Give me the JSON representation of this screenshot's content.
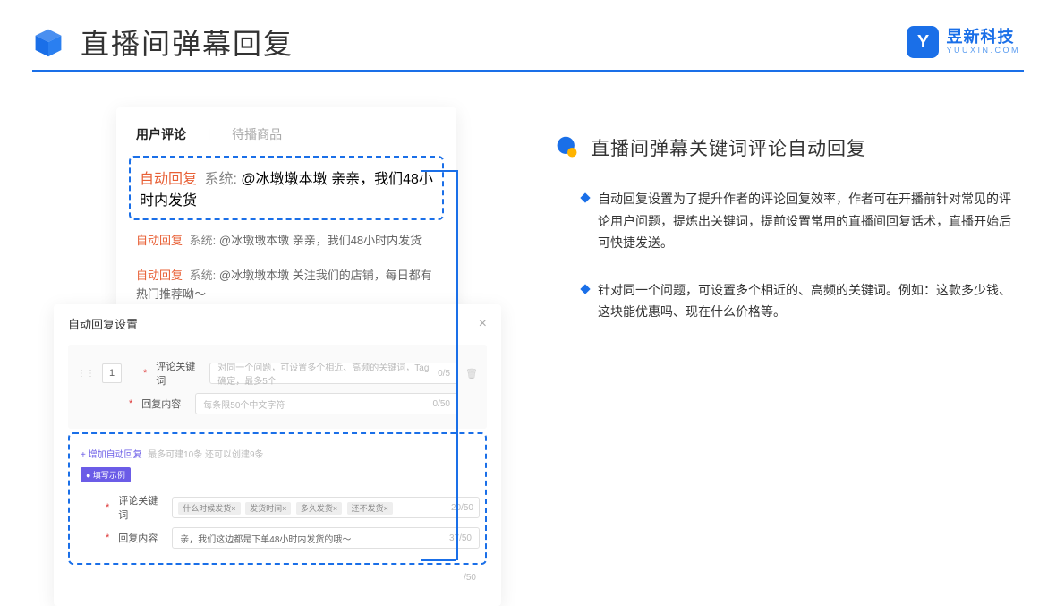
{
  "header": {
    "title": "直播间弹幕回复",
    "logo_cn": "昱新科技",
    "logo_en": "YUUXIN.COM",
    "logo_letter": "Y"
  },
  "comments": {
    "tab_active": "用户评论",
    "tab_inactive": "待播商品",
    "rows": [
      {
        "auto": "自动回复",
        "sys": "系统:",
        "text": "@冰墩墩本墩 亲亲，我们48小时内发货"
      },
      {
        "auto": "自动回复",
        "sys": "系统:",
        "text": "@冰墩墩本墩 亲亲，我们48小时内发货"
      },
      {
        "auto": "自动回复",
        "sys": "系统:",
        "text": "@冰墩墩本墩 关注我们的店铺，每日都有热门推荐呦～"
      }
    ]
  },
  "settings": {
    "title": "自动回复设置",
    "row_num": "1",
    "keyword_label": "评论关键词",
    "keyword_placeholder": "对同一个问题，可设置多个相近、高频的关键词，Tag确定，最多5个",
    "keyword_count": "0/5",
    "content_label": "回复内容",
    "content_placeholder": "每条限50个中文字符",
    "content_count": "0/50",
    "add_label": "+ 增加自动回复",
    "add_hint": "最多可建10条 还可以创建9条",
    "example_badge": "● 填写示例",
    "ex_keyword_label": "评论关键词",
    "ex_tags": [
      "什么时候发货×",
      "发货时间×",
      "多久发货×",
      "还不发货×"
    ],
    "ex_keyword_count": "20/50",
    "ex_content_label": "回复内容",
    "ex_content_value": "亲，我们这边都是下单48小时内发货的哦～",
    "ex_content_count": "37/50",
    "extra_count": "/50"
  },
  "right": {
    "section_title": "直播间弹幕关键词评论自动回复",
    "bullets": [
      "自动回复设置为了提升作者的评论回复效率，作者可在开播前针对常见的评论用户问题，提炼出关键词，提前设置常用的直播间回复话术，直播开始后可快捷发送。",
      "针对同一个问题，可设置多个相近的、高频的关键词。例如：这款多少钱、这块能优惠吗、现在什么价格等。"
    ]
  }
}
